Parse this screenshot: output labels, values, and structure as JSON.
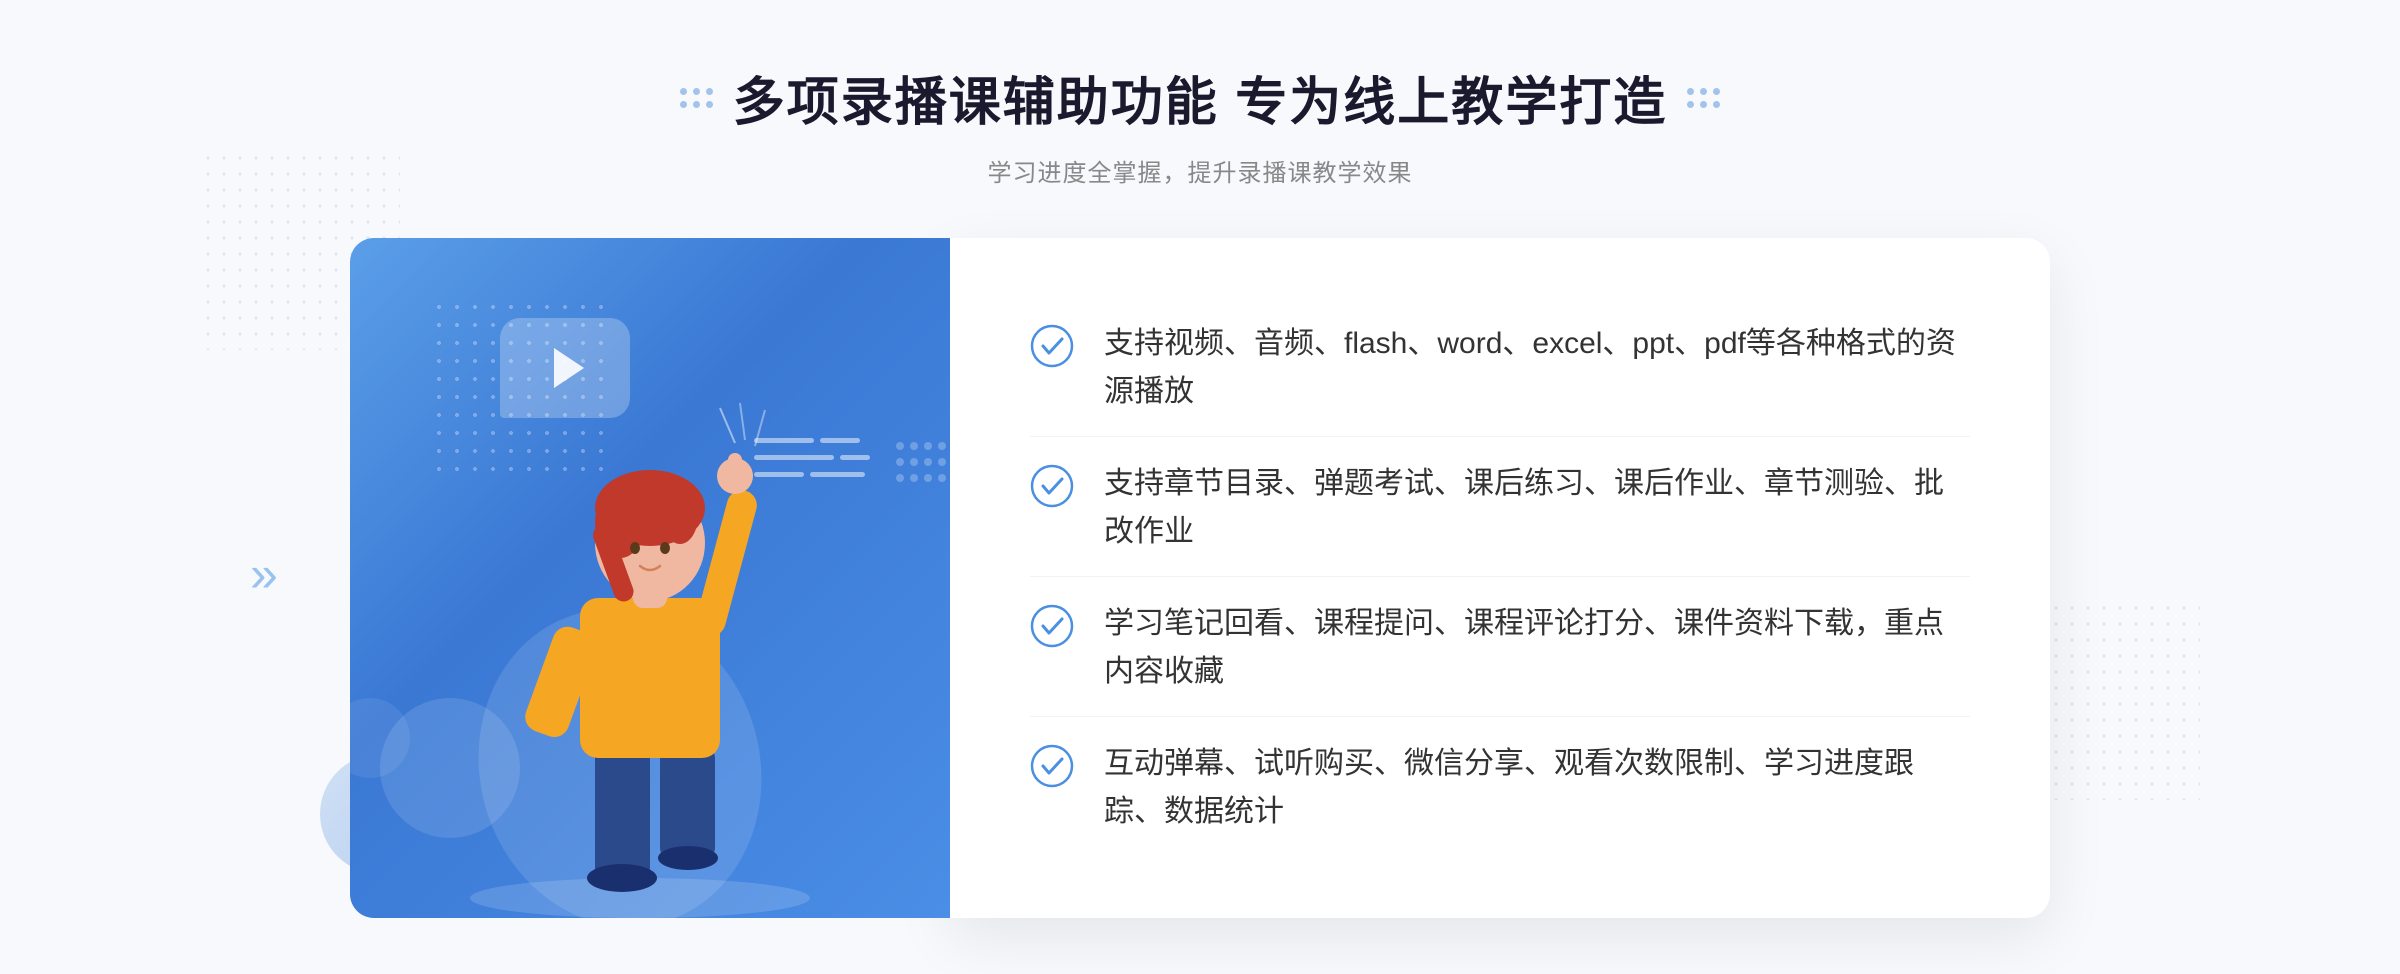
{
  "header": {
    "main_title": "多项录播课辅助功能 专为线上教学打造",
    "sub_title": "学习进度全掌握，提升录播课教学效果",
    "title_dots_aria": "decorative dots"
  },
  "features": [
    {
      "id": 1,
      "text": "支持视频、音频、flash、word、excel、ppt、pdf等各种格式的资源播放"
    },
    {
      "id": 2,
      "text": "支持章节目录、弹题考试、课后练习、课后作业、章节测验、批改作业"
    },
    {
      "id": 3,
      "text": "学习笔记回看、课程提问、课程评论打分、课件资料下载，重点内容收藏"
    },
    {
      "id": 4,
      "text": "互动弹幕、试听购买、微信分享、观看次数限制、学习进度跟踪、数据统计"
    }
  ],
  "illustration": {
    "play_aria": "video play button",
    "figure_aria": "teaching illustration"
  },
  "colors": {
    "primary_blue": "#4a90e2",
    "gradient_start": "#5b9ee8",
    "gradient_end": "#3a78d4",
    "text_dark": "#1a1a2e",
    "text_gray": "#888888",
    "check_color": "#4a90e2"
  }
}
